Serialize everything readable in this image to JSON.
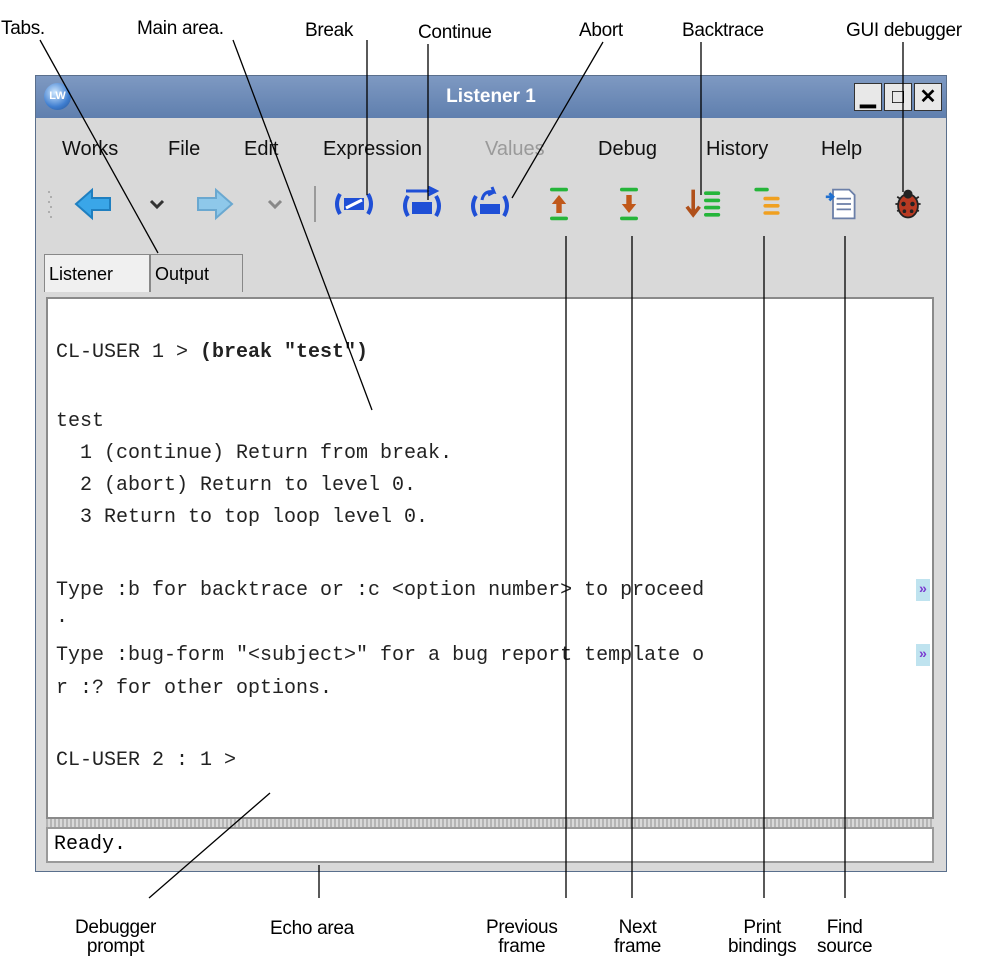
{
  "callouts_top": {
    "tabs": "Tabs.",
    "main_area": "Main area.",
    "break": "Break",
    "continue": "Continue",
    "abort": "Abort",
    "backtrace": "Backtrace",
    "gui_debugger": "GUI debugger"
  },
  "callouts_bottom": {
    "debugger_prompt_1": "Debugger",
    "debugger_prompt_2": "prompt",
    "echo_area": "Echo area",
    "previous_frame_1": "Previous",
    "previous_frame_2": "frame",
    "next_frame_1": "Next",
    "next_frame_2": "frame",
    "print_bindings_1": "Print",
    "print_bindings_2": "bindings",
    "find_source_1": "Find",
    "find_source_2": "source"
  },
  "window": {
    "title": "Listener 1",
    "app_icon_text": "LW",
    "minimize": "▁",
    "maximize": "□",
    "close": "✕"
  },
  "menu": {
    "works": "Works",
    "file": "File",
    "edit": "Edit",
    "expression": "Expression",
    "values": "Values",
    "debug": "Debug",
    "history": "History",
    "help": "Help"
  },
  "toolbar_icons": [
    "back-arrow-icon",
    "dropdown-icon",
    "forward-arrow-icon",
    "dropdown-icon",
    "break-icon",
    "continue-icon",
    "abort-icon",
    "previous-frame-icon",
    "next-frame-icon",
    "backtrace-icon",
    "print-bindings-icon",
    "find-source-icon",
    "gui-debugger-icon"
  ],
  "tabs": {
    "listener": "Listener",
    "output": "Output"
  },
  "editor": {
    "prompt1": "CL-USER 1 > ",
    "cmd1": "(break \"test\")",
    "line_test": "test",
    "opt1": "  1 (continue) Return from break.",
    "opt2": "  2 (abort) Return to level 0.",
    "opt3": "  3 Return to top loop level 0.",
    "type_b": "Type :b for backtrace or :c <option number> to proceed",
    "type_b_cont": ".",
    "type_bug": "Type :bug-form \"<subject>\" for a bug report template o",
    "type_bug_cont": "r :? for other options.",
    "prompt2": "CL-USER 2 : 1 >",
    "wrap_glyph": "»"
  },
  "echo": {
    "text": "Ready."
  }
}
